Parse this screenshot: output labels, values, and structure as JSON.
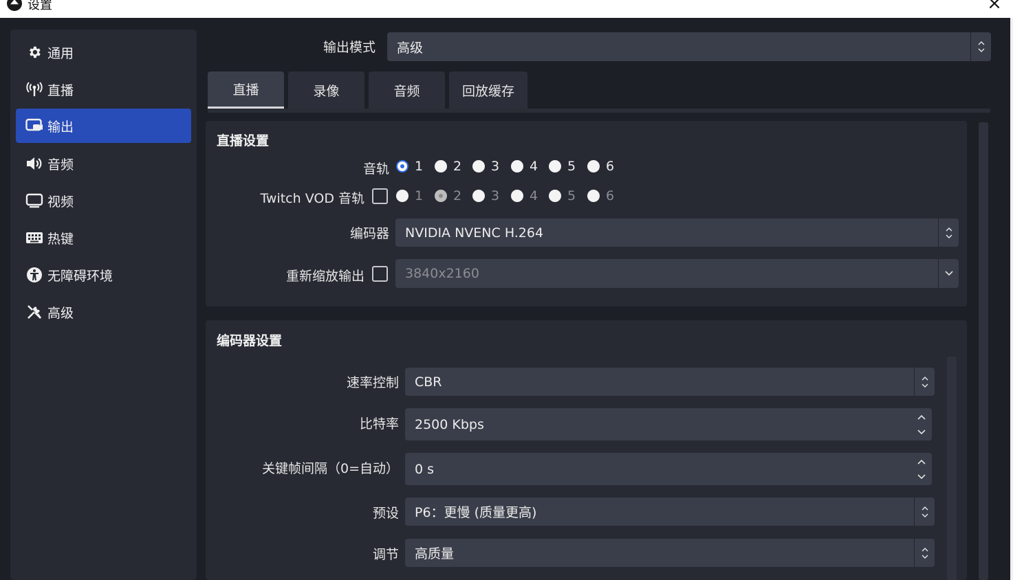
{
  "window": {
    "title": "设置"
  },
  "sidebar": {
    "items": [
      {
        "label": "通用",
        "icon": "gear-icon"
      },
      {
        "label": "直播",
        "icon": "antenna-icon"
      },
      {
        "label": "输出",
        "icon": "output-icon"
      },
      {
        "label": "音频",
        "icon": "speaker-icon"
      },
      {
        "label": "视频",
        "icon": "monitor-icon"
      },
      {
        "label": "热键",
        "icon": "keyboard-icon"
      },
      {
        "label": "无障碍环境",
        "icon": "accessibility-icon"
      },
      {
        "label": "高级",
        "icon": "tools-icon"
      }
    ],
    "active_index": 2
  },
  "output_mode": {
    "label": "输出模式",
    "value": "高级"
  },
  "tabs": [
    "直播",
    "录像",
    "音频",
    "回放缓存"
  ],
  "stream_settings": {
    "title": "直播设置",
    "audio_track": {
      "label": "音轨",
      "options": [
        "1",
        "2",
        "3",
        "4",
        "5",
        "6"
      ],
      "selected": "1"
    },
    "twitch_vod": {
      "label": "Twitch VOD 音轨",
      "options": [
        "1",
        "2",
        "3",
        "4",
        "5",
        "6"
      ],
      "selected": "2"
    },
    "encoder": {
      "label": "编码器",
      "value": "NVIDIA NVENC H.264"
    },
    "rescale": {
      "label": "重新缩放输出",
      "value": "3840x2160"
    }
  },
  "encoder_settings": {
    "title": "编码器设置",
    "rate_control": {
      "label": "速率控制",
      "value": "CBR"
    },
    "bitrate": {
      "label": "比特率",
      "value": "2500 Kbps"
    },
    "keyframe": {
      "label": "关键帧间隔（0=自动）",
      "value": "0 s"
    },
    "preset": {
      "label": "预设",
      "value": "P6：更慢 (质量更高)"
    },
    "tuning": {
      "label": "调节",
      "value": "高质量"
    }
  },
  "colors": {
    "accent": "#284cb8",
    "radio_checked": "#2f6ce5",
    "background": "#1d1f26",
    "panel": "#272a33",
    "field": "#3a3e4a"
  }
}
